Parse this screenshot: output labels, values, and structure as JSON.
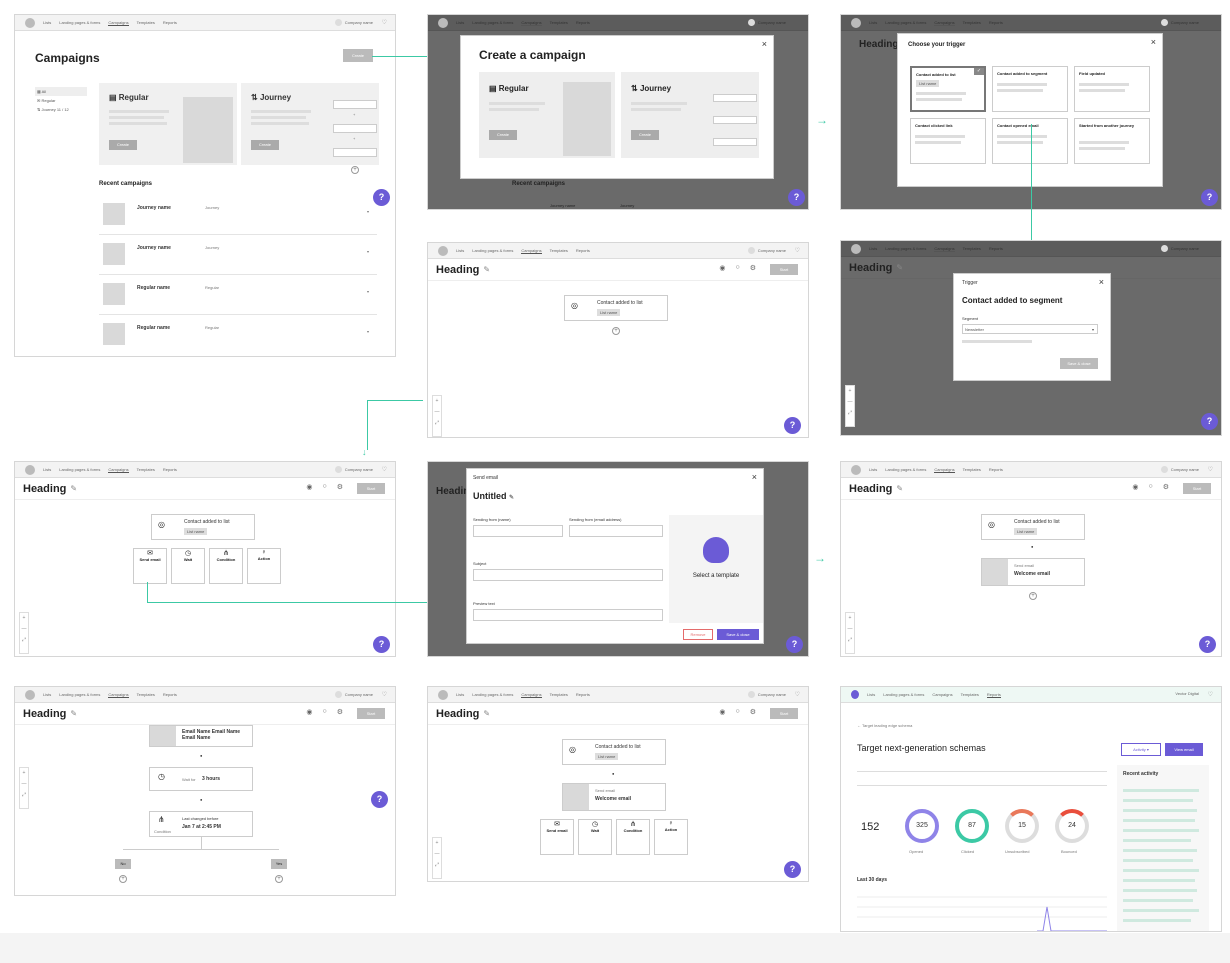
{
  "nav": {
    "items": [
      "Lists",
      "Landing pages & forms",
      "Campaigns",
      "Templates",
      "Reports"
    ],
    "company": "Company name",
    "company_alt": "Vector Digital"
  },
  "campaigns_page": {
    "title": "Campaigns",
    "create_label": "Create",
    "filters": [
      "All",
      "Regular",
      "Journey"
    ],
    "journey_count": "11 / 12",
    "regular": {
      "title": "Regular",
      "button": "Create"
    },
    "journey": {
      "title": "Journey",
      "button": "Create"
    },
    "recent_title": "Recent campaigns",
    "recent": [
      {
        "name": "Journey name",
        "type": "Journey"
      },
      {
        "name": "Journey name",
        "type": "Journey"
      },
      {
        "name": "Regular name",
        "type": "Regular"
      },
      {
        "name": "Regular name",
        "type": "Regular"
      }
    ]
  },
  "create_modal": {
    "title": "Create a campaign",
    "regular": "Regular",
    "journey": "Journey",
    "button": "Create",
    "recent_title": "Recent campaigns",
    "recent_row": "Journey name",
    "recent_type": "Journey"
  },
  "trigger_modal": {
    "heading_bg": "Heading",
    "title": "Choose your trigger",
    "options": [
      {
        "title": "Contact added to list",
        "tag": "List name"
      },
      {
        "title": "Contact added to segment"
      },
      {
        "title": "Field updated"
      },
      {
        "title": "Contact clicked link"
      },
      {
        "title": "Contact opened email"
      },
      {
        "title": "Started from another journey"
      }
    ]
  },
  "editor": {
    "heading": "Heading",
    "start": "Start",
    "tools": [
      "Show",
      "Stop"
    ],
    "trigger_title": "Contact added to list",
    "trigger_tag": "List name",
    "trigger_icon_label": "Trigger",
    "actions": [
      {
        "title": "Send email"
      },
      {
        "title": "Wait"
      },
      {
        "title": "Condition"
      },
      {
        "title": "Action"
      }
    ],
    "email_block": "Welcome email",
    "email_block_sub": "Send email"
  },
  "segment_modal": {
    "label": "Trigger",
    "title": "Contact added to segment",
    "field": "Segment",
    "value": "Newsletter",
    "save": "Save & close"
  },
  "send_email_modal": {
    "label": "Send email",
    "title": "Untitled",
    "from_name": "Sending from (name)",
    "from_email": "Sending from (email address)",
    "subject": "Subject",
    "preview": "Preview text",
    "template": "Select a template",
    "remove": "Remove",
    "save": "Save & close",
    "heading_bg": "Heading"
  },
  "flow_page": {
    "heading": "Heading",
    "email_node": "Email Name Email Name\nEmail Name",
    "wait_label": "Wait for",
    "wait_value": "3 hours",
    "condition_title": "Last changed before",
    "condition_value": "Jan 7 at 2:45 PM",
    "condition_icon": "Condition",
    "no_label": "No",
    "yes_label": "Yes"
  },
  "report": {
    "back": "Target leading edge schema",
    "title": "Target next-generation schemas",
    "activity": "Activity",
    "view_email": "View email",
    "recent_activity": "Recent activity",
    "total": "152",
    "rings": [
      {
        "value": "325",
        "label": "Opened"
      },
      {
        "value": "87",
        "label": "Clicked"
      },
      {
        "value": "15",
        "label": "Unsubscribed"
      },
      {
        "value": "24",
        "label": "Bounced"
      }
    ],
    "last30": "Last 30 days",
    "ring_colors": [
      "#8f84e8",
      "#3cc9a5",
      "#e9785a",
      "#e94e3c"
    ]
  },
  "colors": {
    "teal": "#3cc9a5",
    "purple": "#6b5bd6"
  },
  "help_label": "?"
}
